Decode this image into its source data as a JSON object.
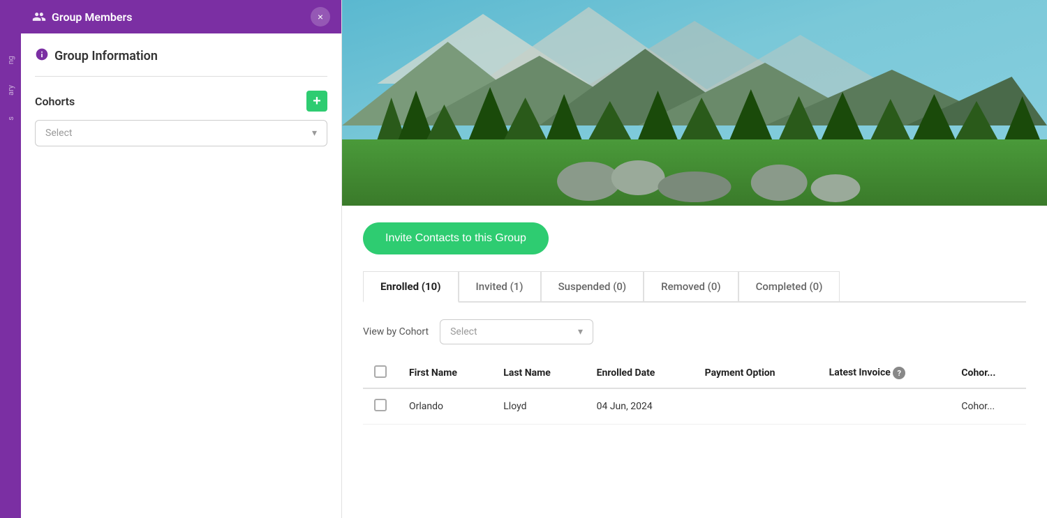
{
  "sidebar": {
    "header": {
      "title": "Group Members",
      "close_label": "×"
    },
    "group_info": {
      "label": "Group Information"
    },
    "cohorts": {
      "title": "Cohorts",
      "add_label": "+",
      "select_placeholder": "Select"
    }
  },
  "partial_nav": {
    "items": [
      {
        "label": "ng"
      },
      {
        "label": "ary"
      },
      {
        "label": "s"
      }
    ]
  },
  "main": {
    "invite_button": "Invite Contacts to this Group",
    "tabs": [
      {
        "label": "Enrolled (10)",
        "active": true
      },
      {
        "label": "Invited (1)",
        "active": false
      },
      {
        "label": "Suspended (0)",
        "active": false
      },
      {
        "label": "Removed (0)",
        "active": false
      },
      {
        "label": "Completed (0)",
        "active": false
      }
    ],
    "filter": {
      "label": "View by Cohort",
      "select_placeholder": "Select"
    },
    "table": {
      "columns": [
        {
          "key": "checkbox",
          "label": ""
        },
        {
          "key": "first_name",
          "label": "First Name"
        },
        {
          "key": "last_name",
          "label": "Last Name"
        },
        {
          "key": "enrolled_date",
          "label": "Enrolled Date"
        },
        {
          "key": "payment_option",
          "label": "Payment Option"
        },
        {
          "key": "latest_invoice",
          "label": "Latest Invoice"
        },
        {
          "key": "cohort",
          "label": "Cohor..."
        }
      ],
      "rows": [
        {
          "first_name": "Orlando",
          "last_name": "Lloyd",
          "enrolled_date": "04 Jun, 2024",
          "payment_option": "",
          "latest_invoice": "",
          "cohort": "Cohor..."
        }
      ]
    }
  }
}
